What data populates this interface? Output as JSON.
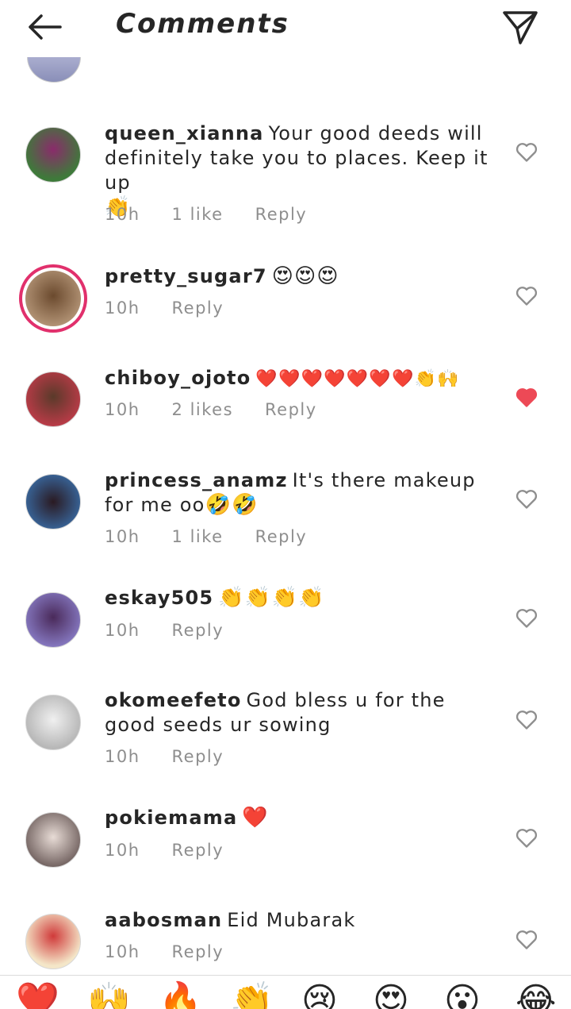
{
  "header": {
    "title": "Comments"
  },
  "comments": [
    {
      "username": "queen_xianna",
      "text": "Your good deeds will definitely take you to places. Keep it up",
      "emoji": "👏",
      "time": "10h",
      "likes": "1 like",
      "reply": "Reply",
      "liked": false
    },
    {
      "username": "pretty_sugar7",
      "text": "",
      "emoji": "😍😍😍",
      "time": "10h",
      "likes": "",
      "reply": "Reply",
      "liked": false
    },
    {
      "username": "chiboy_ojoto",
      "text": "",
      "emoji": "❤️❤️❤️❤️❤️❤️❤️👏🙌",
      "time": "10h",
      "likes": "2 likes",
      "reply": "Reply",
      "liked": true
    },
    {
      "username": "princess_anamz",
      "text": "It's there makeup for me oo",
      "emoji": "🤣🤣",
      "time": "10h",
      "likes": "1 like",
      "reply": "Reply",
      "liked": false
    },
    {
      "username": "eskay505",
      "text": "",
      "emoji": "👏👏👏👏",
      "time": "10h",
      "likes": "",
      "reply": "Reply",
      "liked": false
    },
    {
      "username": "okomeefeto",
      "text": "God bless u for the good seeds ur sowing",
      "emoji": "",
      "time": "10h",
      "likes": "",
      "reply": "Reply",
      "liked": false
    },
    {
      "username": "pokiemama",
      "text": "",
      "emoji": "❤️",
      "time": "10h",
      "likes": "",
      "reply": "Reply",
      "liked": false
    },
    {
      "username": "aabosman",
      "text": "Eid Mubarak",
      "emoji": "",
      "time": "10h",
      "likes": "",
      "reply": "Reply",
      "liked": false
    }
  ],
  "reactions": [
    "❤️",
    "🙌",
    "🔥",
    "👏",
    "😢",
    "😍",
    "😮",
    "😂"
  ],
  "colors": {
    "liked_heart": "#ed4956",
    "meta_text": "#8e8e8e",
    "story_ring": "#e1306c"
  },
  "icons": {
    "back": "arrow-left-icon",
    "send": "paper-plane-icon",
    "like": "heart-outline-icon",
    "liked": "heart-filled-icon"
  }
}
